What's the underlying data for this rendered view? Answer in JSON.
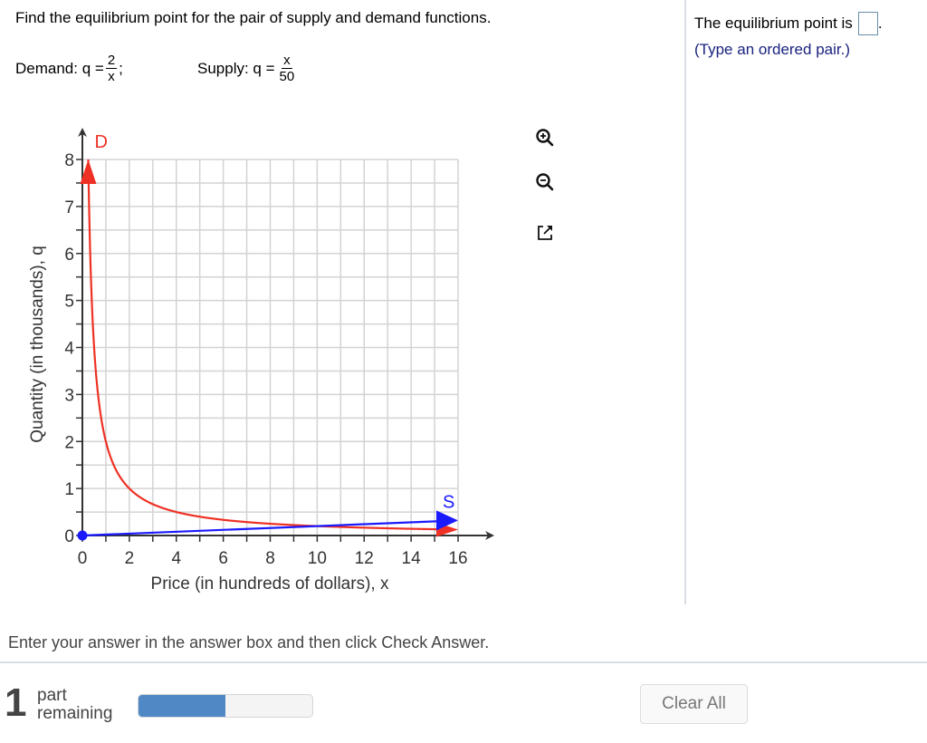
{
  "question": {
    "prompt": "Find the equilibrium point for the pair of supply and demand functions.",
    "demand": {
      "label": "Demand: q =",
      "numerator": "2",
      "denominator": "x",
      "suffix": ";"
    },
    "supply": {
      "label": "Supply: q =",
      "numerator": "x",
      "denominator": "50"
    }
  },
  "answer": {
    "prefix": "The equilibrium point is",
    "suffix": ".",
    "value": "",
    "hint": "(Type an ordered pair.)"
  },
  "graph_tools": [
    {
      "name": "zoom-in-icon"
    },
    {
      "name": "zoom-out-icon"
    },
    {
      "name": "open-new-window-icon"
    }
  ],
  "colors": {
    "demand": "#ee3124",
    "supply": "#1a1aff",
    "grid": "#d3d3d3",
    "axis": "#333333",
    "progress": "#5088c5"
  },
  "chart_data": {
    "type": "line",
    "xlabel": "Price (in hundreds of dollars), x",
    "ylabel": "Quantity (in thousands), q",
    "xlim": [
      0,
      16
    ],
    "ylim": [
      0,
      8
    ],
    "x_ticks": [
      0,
      2,
      4,
      6,
      8,
      10,
      12,
      14,
      16
    ],
    "y_ticks": [
      0,
      1,
      2,
      3,
      4,
      5,
      6,
      7,
      8
    ],
    "x_grid_step": 1,
    "y_grid_step": 0.5,
    "grid": true,
    "series": [
      {
        "name": "D",
        "formula": "q = 2/x",
        "x_start": 0.25,
        "x_end": 16,
        "color": "#ee3124"
      },
      {
        "name": "S",
        "formula": "q = x/50",
        "x_start": 0,
        "x_end": 16,
        "color": "#1a1aff",
        "start_point": [
          0,
          0
        ]
      }
    ]
  },
  "footer": {
    "instruction": "Enter your answer in the answer box and then click Check Answer.",
    "parts_count": "1",
    "parts_label_1": "part",
    "parts_label_2": "remaining",
    "progress_fraction": 0.5,
    "clear_label": "Clear All"
  }
}
